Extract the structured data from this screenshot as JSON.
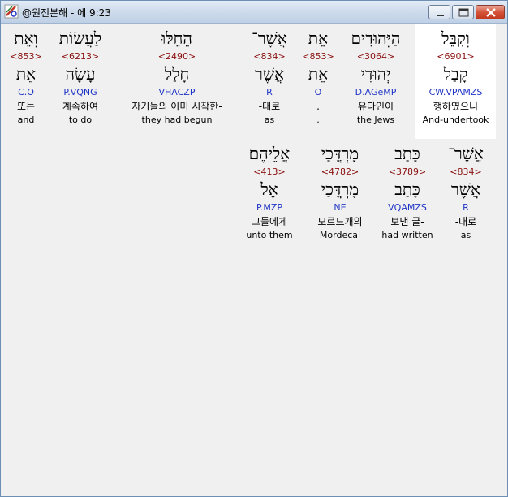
{
  "window": {
    "title": "@원전본해 - 에 9:23"
  },
  "rows": [
    {
      "words": [
        {
          "heb": "וְקִבֵּל",
          "strong": "<6901>",
          "lemma": "קָבַל",
          "parse": "CW.VPAMZS",
          "kor": "행하였으니",
          "eng": "And-undertook",
          "highlighted": true
        },
        {
          "heb": "הַיְּהוּדִים",
          "strong": "<3064>",
          "lemma": "יְהוּדִי",
          "parse": "D.AGeMP",
          "kor": "유다인이",
          "eng": "the Jews"
        },
        {
          "heb": "אֵת",
          "strong": "<853>",
          "lemma": "אֵת",
          "parse": "O",
          "kor": ".",
          "eng": "."
        },
        {
          "heb": "אֲשֶׁר־",
          "strong": "<834>",
          "lemma": "אֲשֶׁר",
          "parse": "R",
          "kor": "-대로",
          "eng": "as"
        },
        {
          "heb": "הֵחֵלּוּ",
          "strong": "<2490>",
          "lemma": "חָלַל",
          "parse": "VHACZP",
          "kor": "자기들의 이미 시작한-",
          "eng": "they had begun"
        },
        {
          "heb": "לַעֲשׂוֹת",
          "strong": "<6213>",
          "lemma": "עָשָׂה",
          "parse": "P.VQNG",
          "kor": "계속하여",
          "eng": "to do"
        },
        {
          "heb": "וְאֵת",
          "strong": "<853>",
          "lemma": "אֵת",
          "parse": "C.O",
          "kor": "또는",
          "eng": "and"
        }
      ]
    },
    {
      "words": [
        {
          "heb": "אֲשֶׁר־",
          "strong": "<834>",
          "lemma": "אֲשֶׁר",
          "parse": "R",
          "kor": "-대로",
          "eng": "as"
        },
        {
          "heb": "כָּתַב",
          "strong": "<3789>",
          "lemma": "כָּתַב",
          "parse": "VQAMZS",
          "kor": "보낸 글-",
          "eng": "had written"
        },
        {
          "heb": "מָרְדֳּכַי",
          "strong": "<4782>",
          "lemma": "מָרְדֳּכַי",
          "parse": "NE",
          "kor": "모르드개의",
          "eng": "Mordecai"
        },
        {
          "heb": "אֲלֵיהֶם׃",
          "strong": "<413>",
          "lemma": "אֶל",
          "parse": "P.MZP",
          "kor": "그들에게",
          "eng": "unto them"
        }
      ]
    }
  ],
  "colors": {
    "strong": "#8b1010",
    "parse": "#1f34c6",
    "highlight": "#ffffff"
  }
}
